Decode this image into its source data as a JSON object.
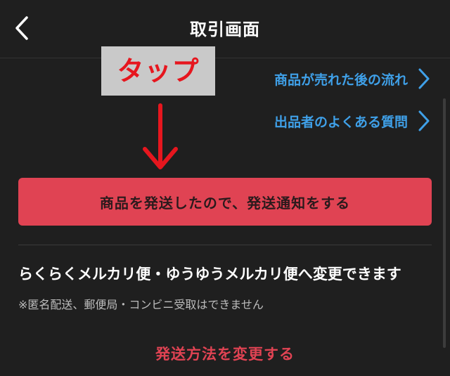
{
  "header": {
    "title": "取引画面",
    "back_icon": "chevron-left-icon"
  },
  "annotation": {
    "tap_label": "タップ",
    "arrow_icon": "arrow-down-icon",
    "colors": {
      "label_bg": "#c9c9c9",
      "label_text": "#e6161e",
      "arrow": "#e6161e"
    }
  },
  "links": [
    {
      "label": "商品が売れた後の流れ",
      "icon": "chevron-right-icon"
    },
    {
      "label": "出品者のよくある質問",
      "icon": "chevron-right-icon"
    }
  ],
  "shipping_button": {
    "label": "商品を発送したので、発送通知をする"
  },
  "shipping_info": {
    "main_text": "らくらくメルカリ便・ゆうゆうメルカリ便へ変更できます",
    "note_text": "※匿名配送、郵便局・コンビニ受取はできません",
    "change_link": "発送方法を変更する"
  },
  "colors": {
    "background": "#1f1f1f",
    "accent": "#e04353",
    "link": "#3fa0e8"
  }
}
